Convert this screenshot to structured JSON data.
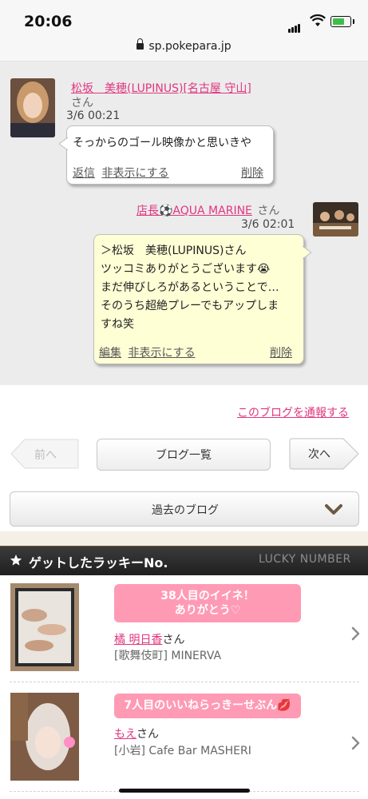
{
  "status": {
    "time": "20:06",
    "url": "sp.pokepara.jp"
  },
  "comments": [
    {
      "name": "松坂　美穂(LUPINUS)[名古屋 守山]",
      "suffix": "さん",
      "date": "3/6 00:21",
      "text": "そっからのゴール映像かと思いきや",
      "actions": [
        "返信",
        "非表示にする",
        "削除"
      ]
    },
    {
      "name": "店長⚽AQUA MARINE",
      "suffix": "さん",
      "date": "3/6 02:01",
      "text_lines": [
        "＞松坂　美穂(LUPINUS)さん",
        "ツッコミありがとうございます😭",
        "まだ伸びしろがあるということで…",
        "そのうち超絶プレーでもアップしま",
        "すね笑"
      ],
      "actions": [
        "編集",
        "非表示にする",
        "削除"
      ]
    }
  ],
  "report_link": "このブログを通報する",
  "pagination": {
    "prev": "前へ",
    "list": "ブログ一覧",
    "next": "次へ"
  },
  "past_blog": "過去のブログ",
  "lucky": {
    "title": "ゲットしたラッキーNo.",
    "subtitle": "LUCKY NUMBER",
    "items": [
      {
        "message": "38人目のイイネ！\nありがとう♡",
        "name": "橘 明日香",
        "suffix": "さん",
        "shop": "[歌舞伎町] MINERVA"
      },
      {
        "message": "7人目のいいねらっきーせぶん💋",
        "name": "もえ",
        "suffix": "さん",
        "shop": "[小岩] Cafe Bar MASHERI"
      }
    ]
  },
  "colors": {
    "accent_pink": "#e0367f",
    "bubble_pink": "#ff9ab5",
    "yellow_bubble": "#ffffd6"
  }
}
